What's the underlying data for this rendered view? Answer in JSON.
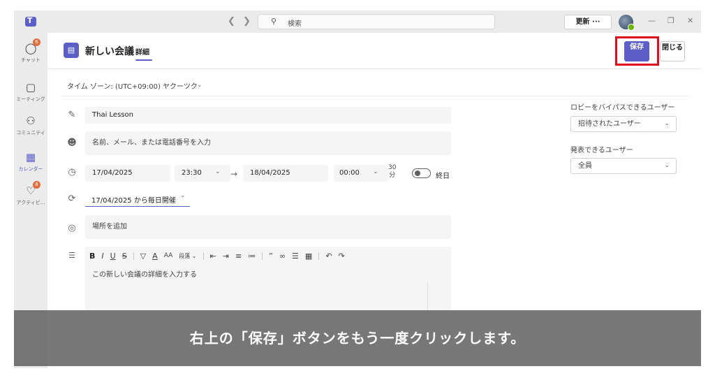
{
  "titlebar": {
    "search_placeholder": "検索",
    "update_label": "更新 ···"
  },
  "rail": {
    "items": [
      {
        "label": "チャット",
        "icon": "chat-icon",
        "badge": "6"
      },
      {
        "label": "ミーティング",
        "icon": "video-icon"
      },
      {
        "label": "コミュニティ",
        "icon": "community-icon"
      },
      {
        "label": "カレンダー",
        "icon": "calendar-icon",
        "active": true
      },
      {
        "label": "アクティビ...",
        "icon": "bell-icon",
        "badge": "8"
      }
    ]
  },
  "header": {
    "title": "新しい会議",
    "tab": "詳細",
    "save_label": "保存",
    "close_label": "閉じる"
  },
  "form": {
    "timezone": "タイム ゾーン: (UTC+09:00) ヤクーツク",
    "title_value": "Thai Lesson",
    "attendees_placeholder": "名前、メール、または電話番号を入力",
    "start_date": "17/04/2025",
    "start_time": "23:30",
    "end_date": "18/04/2025",
    "end_time": "00:00",
    "duration_num": "30",
    "duration_unit": "分",
    "allday_label": "終日",
    "recurrence": "17/04/2025 から毎日開催",
    "location_placeholder": "場所を追加",
    "editor_paragraph": "段落",
    "editor_placeholder": "この新しい会議の詳細を入力する"
  },
  "side": {
    "lobby_label": "ロビーをバイパスできるユーザー",
    "lobby_value": "招待されたユーザー",
    "presenters_label": "発表できるユーザー",
    "presenters_value": "全員"
  },
  "caption": "右上の「保存」ボタンをもう一度クリックします。",
  "colors": {
    "accent": "#5b5fc7",
    "highlight": "#e00b1c",
    "badge": "#e36e3b"
  }
}
